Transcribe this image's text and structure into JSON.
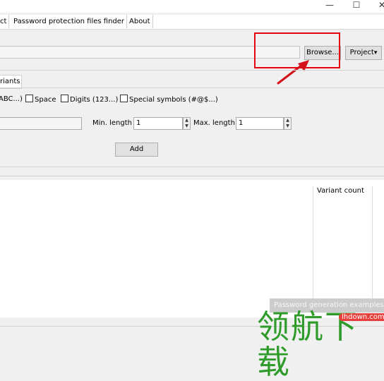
{
  "window": {
    "minimize_glyph": "—",
    "maximize_glyph": "☐",
    "close_glyph": "✕"
  },
  "menu": {
    "tab_project_partial": "ct",
    "tab_finder": "Password protection files finder",
    "tab_about": "About"
  },
  "file": {
    "browse_label": "Browse...",
    "project_label": "Project",
    "project_arrow": "▾"
  },
  "variants": {
    "tab_label": "riants",
    "charsets": [
      {
        "label": "ABC...)",
        "checked": true
      },
      {
        "label": "Space",
        "checked": false
      },
      {
        "label": "Digits (123...)",
        "checked": false
      },
      {
        "label": "Special symbols (#@$...)",
        "checked": false
      }
    ],
    "min_length_label": "Min. length",
    "min_length_value": "1",
    "max_length_label": "Max. length",
    "max_length_value": "1",
    "add_label": "Add"
  },
  "results": {
    "variant_count_header": "Variant count",
    "examples_button_label": "Password generation examples"
  },
  "watermark": {
    "brand": "领航下载",
    "url": "lhdown.com"
  },
  "annotation": {
    "highlight_color": "#e60012",
    "arrow_color": "#d4111b"
  }
}
